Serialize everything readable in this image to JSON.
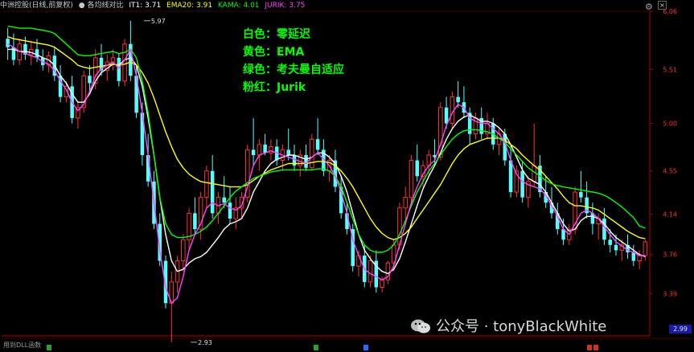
{
  "header": {
    "title": "中洲控股(日线,前复权)",
    "indicator_name": "● 各均线对比",
    "values": [
      {
        "label": "IT1: 3.71",
        "color": "#ffffff"
      },
      {
        "label": "EMA20: 3.91",
        "color": "#ffff00"
      },
      {
        "label": "KAMA: 4.01",
        "color": "#00ff00"
      },
      {
        "label": "JURIK: 3.75",
        "color": "#ff44ff"
      }
    ]
  },
  "legend": [
    {
      "text": "白色：零延迟",
      "color": "#ffffff"
    },
    {
      "text": "黄色：EMA",
      "color": "#ffff00"
    },
    {
      "text": "绿色：考夫曼自适应",
      "color": "#00ff00"
    },
    {
      "text": "粉红：Jurik",
      "color": "#ff44ff"
    }
  ],
  "footer_text": "用到DLL函数",
  "watermark": "公众号 · tonyBlackWhite",
  "chart_data": {
    "type": "candlestick",
    "y_ticks": [
      6.06,
      5.51,
      5.0,
      4.55,
      4.14,
      3.76,
      3.39
    ],
    "y_bottom_label": "2.99",
    "ylim": [
      2.99,
      6.06
    ],
    "annotations": [
      {
        "text": "5.97",
        "x": 23,
        "y": 5.97
      },
      {
        "text": "2.93",
        "x": 31,
        "y": 2.93
      }
    ],
    "colors": {
      "up": "#ff3232",
      "down": "#54ffff",
      "zero_lag": "#ffffff",
      "ema": "#ffff00",
      "kama": "#00ff00",
      "jurik": "#ff44ff",
      "axis": "#b00000",
      "tick_text": "#ff3232"
    },
    "candles": [
      [
        5.8,
        5.9,
        5.6,
        5.72
      ],
      [
        5.72,
        5.85,
        5.55,
        5.6
      ],
      [
        5.6,
        5.8,
        5.55,
        5.75
      ],
      [
        5.75,
        5.82,
        5.6,
        5.65
      ],
      [
        5.65,
        5.78,
        5.55,
        5.7
      ],
      [
        5.7,
        5.8,
        5.58,
        5.62
      ],
      [
        5.62,
        5.7,
        5.5,
        5.55
      ],
      [
        5.55,
        5.68,
        5.48,
        5.64
      ],
      [
        5.64,
        5.72,
        5.4,
        5.45
      ],
      [
        5.45,
        5.55,
        5.2,
        5.25
      ],
      [
        5.25,
        5.4,
        5.2,
        5.35
      ],
      [
        5.35,
        5.45,
        5.0,
        5.05
      ],
      [
        5.05,
        5.2,
        4.95,
        5.15
      ],
      [
        5.15,
        5.5,
        5.1,
        5.45
      ],
      [
        5.45,
        5.55,
        5.3,
        5.38
      ],
      [
        5.38,
        5.7,
        5.32,
        5.62
      ],
      [
        5.62,
        5.75,
        5.45,
        5.5
      ],
      [
        5.5,
        5.65,
        5.4,
        5.58
      ],
      [
        5.58,
        5.7,
        5.5,
        5.62
      ],
      [
        5.62,
        5.66,
        5.35,
        5.4
      ],
      [
        5.4,
        5.8,
        5.35,
        5.75
      ],
      [
        5.75,
        5.97,
        5.4,
        5.45
      ],
      [
        5.45,
        5.55,
        5.05,
        5.1
      ],
      [
        5.1,
        5.2,
        4.6,
        4.7
      ],
      [
        4.7,
        4.9,
        4.4,
        4.45
      ],
      [
        4.45,
        4.55,
        4.0,
        4.05
      ],
      [
        4.05,
        4.15,
        3.65,
        3.7
      ],
      [
        3.7,
        3.75,
        3.25,
        3.3
      ],
      [
        3.3,
        3.6,
        2.93,
        3.5
      ],
      [
        3.5,
        3.75,
        3.4,
        3.7
      ],
      [
        3.7,
        3.95,
        3.6,
        3.9
      ],
      [
        3.9,
        4.2,
        3.8,
        4.15
      ],
      [
        4.15,
        4.3,
        3.95,
        4.0
      ],
      [
        4.0,
        4.35,
        3.9,
        4.3
      ],
      [
        4.3,
        4.6,
        4.2,
        4.55
      ],
      [
        4.55,
        4.7,
        4.1,
        4.15
      ],
      [
        4.15,
        4.35,
        4.05,
        4.3
      ],
      [
        4.3,
        4.5,
        4.2,
        4.25
      ],
      [
        4.25,
        4.4,
        4.05,
        4.1
      ],
      [
        4.1,
        4.3,
        4.0,
        4.2
      ],
      [
        4.2,
        4.35,
        4.1,
        4.3
      ],
      [
        4.3,
        4.8,
        4.25,
        4.75
      ],
      [
        4.75,
        5.05,
        4.6,
        4.7
      ],
      [
        4.7,
        4.85,
        4.55,
        4.8
      ],
      [
        4.8,
        4.9,
        4.7,
        4.72
      ],
      [
        4.72,
        4.85,
        4.65,
        4.78
      ],
      [
        4.78,
        4.85,
        4.6,
        4.65
      ],
      [
        4.65,
        4.8,
        4.55,
        4.75
      ],
      [
        4.75,
        4.95,
        4.65,
        4.7
      ],
      [
        4.7,
        4.8,
        4.55,
        4.6
      ],
      [
        4.6,
        4.75,
        4.5,
        4.7
      ],
      [
        4.7,
        4.8,
        4.55,
        4.58
      ],
      [
        4.58,
        4.9,
        4.55,
        4.85
      ],
      [
        4.85,
        5.05,
        4.7,
        4.75
      ],
      [
        4.75,
        4.85,
        4.5,
        4.55
      ],
      [
        4.55,
        4.7,
        4.45,
        4.65
      ],
      [
        4.65,
        4.75,
        4.35,
        4.4
      ],
      [
        4.4,
        4.5,
        4.1,
        4.15
      ],
      [
        4.15,
        4.25,
        3.95,
        4.0
      ],
      [
        4.0,
        4.05,
        3.6,
        3.65
      ],
      [
        3.65,
        3.8,
        3.55,
        3.75
      ],
      [
        3.75,
        3.85,
        3.45,
        3.5
      ],
      [
        3.5,
        3.75,
        3.45,
        3.7
      ],
      [
        3.7,
        3.8,
        3.4,
        3.45
      ],
      [
        3.45,
        3.55,
        3.4,
        3.52
      ],
      [
        3.52,
        3.7,
        3.48,
        3.68
      ],
      [
        3.68,
        3.9,
        3.6,
        3.85
      ],
      [
        3.85,
        4.25,
        3.8,
        4.2
      ],
      [
        4.2,
        4.4,
        4.1,
        4.3
      ],
      [
        4.3,
        4.7,
        4.25,
        4.65
      ],
      [
        4.65,
        4.8,
        4.45,
        4.5
      ],
      [
        4.5,
        4.65,
        4.4,
        4.6
      ],
      [
        4.6,
        4.75,
        4.5,
        4.7
      ],
      [
        4.7,
        4.85,
        4.6,
        4.68
      ],
      [
        4.68,
        5.2,
        4.65,
        5.15
      ],
      [
        5.15,
        5.25,
        4.95,
        5.0
      ],
      [
        5.0,
        5.3,
        4.95,
        5.25
      ],
      [
        5.25,
        5.4,
        5.15,
        5.2
      ],
      [
        5.2,
        5.35,
        5.05,
        5.1
      ],
      [
        5.1,
        5.15,
        4.8,
        4.9
      ],
      [
        4.9,
        5.1,
        4.85,
        5.05
      ],
      [
        5.05,
        5.15,
        4.85,
        4.9
      ],
      [
        4.9,
        5.1,
        4.85,
        5.0
      ],
      [
        5.0,
        5.05,
        4.75,
        4.8
      ],
      [
        4.8,
        4.95,
        4.7,
        4.9
      ],
      [
        4.9,
        4.95,
        4.6,
        4.65
      ],
      [
        4.65,
        4.8,
        4.3,
        4.35
      ],
      [
        4.35,
        4.6,
        4.3,
        4.55
      ],
      [
        4.55,
        4.65,
        4.25,
        4.3
      ],
      [
        4.3,
        4.5,
        4.2,
        4.45
      ],
      [
        4.45,
        5.0,
        4.4,
        4.6
      ],
      [
        4.6,
        4.7,
        4.3,
        4.35
      ],
      [
        4.35,
        4.5,
        4.2,
        4.25
      ],
      [
        4.25,
        4.4,
        4.1,
        4.15
      ],
      [
        4.15,
        4.25,
        3.95,
        4.0
      ],
      [
        4.0,
        4.1,
        3.85,
        3.9
      ],
      [
        3.9,
        4.05,
        3.85,
        4.0
      ],
      [
        4.0,
        4.4,
        3.95,
        4.35
      ],
      [
        4.35,
        4.55,
        4.25,
        4.3
      ],
      [
        4.3,
        4.45,
        4.1,
        4.15
      ],
      [
        4.15,
        4.25,
        3.95,
        4.05
      ],
      [
        4.05,
        4.15,
        3.9,
        4.1
      ],
      [
        4.1,
        4.2,
        3.85,
        3.9
      ],
      [
        3.9,
        4.0,
        3.78,
        3.85
      ],
      [
        3.85,
        3.95,
        3.75,
        3.8
      ],
      [
        3.8,
        3.9,
        3.7,
        3.85
      ],
      [
        3.85,
        3.95,
        3.72,
        3.78
      ],
      [
        3.78,
        3.85,
        3.65,
        3.7
      ],
      [
        3.7,
        3.8,
        3.62,
        3.75
      ],
      [
        3.75,
        3.9,
        3.7,
        3.88
      ]
    ],
    "series": [
      {
        "name": "零延迟",
        "color": "#ffffff",
        "values": [
          5.7,
          5.7,
          5.68,
          5.68,
          5.67,
          5.65,
          5.62,
          5.6,
          5.55,
          5.45,
          5.38,
          5.28,
          5.2,
          5.2,
          5.28,
          5.4,
          5.48,
          5.52,
          5.56,
          5.55,
          5.6,
          5.62,
          5.55,
          5.35,
          5.05,
          4.7,
          4.3,
          3.95,
          3.7,
          3.6,
          3.62,
          3.68,
          3.72,
          3.74,
          3.78,
          3.85,
          3.92,
          4.0,
          4.05,
          4.07,
          4.1,
          4.2,
          4.35,
          4.45,
          4.55,
          4.62,
          4.66,
          4.68,
          4.7,
          4.7,
          4.68,
          4.66,
          4.68,
          4.72,
          4.72,
          4.68,
          4.62,
          4.5,
          4.35,
          4.15,
          3.95,
          3.8,
          3.72,
          3.65,
          3.6,
          3.58,
          3.62,
          3.72,
          3.88,
          4.05,
          4.22,
          4.38,
          4.5,
          4.6,
          4.72,
          4.85,
          4.95,
          5.02,
          5.06,
          5.08,
          5.05,
          5.02,
          5.02,
          5.0,
          4.96,
          4.9,
          4.8,
          4.68,
          4.56,
          4.48,
          4.45,
          4.42,
          4.35,
          4.25,
          4.15,
          4.05,
          3.98,
          4.0,
          4.08,
          4.12,
          4.12,
          4.1,
          4.05,
          3.98,
          3.92,
          3.88,
          3.84,
          3.8,
          3.76,
          3.74
        ]
      },
      {
        "name": "EMA",
        "color": "#ffff00",
        "values": [
          5.82,
          5.8,
          5.79,
          5.78,
          5.77,
          5.76,
          5.75,
          5.74,
          5.72,
          5.68,
          5.64,
          5.6,
          5.55,
          5.53,
          5.52,
          5.53,
          5.54,
          5.55,
          5.56,
          5.55,
          5.56,
          5.58,
          5.55,
          5.48,
          5.38,
          5.24,
          5.08,
          4.92,
          4.78,
          4.66,
          4.58,
          4.52,
          4.48,
          4.45,
          4.44,
          4.43,
          4.42,
          4.41,
          4.4,
          4.4,
          4.4,
          4.42,
          4.46,
          4.5,
          4.53,
          4.56,
          4.58,
          4.6,
          4.62,
          4.62,
          4.62,
          4.62,
          4.63,
          4.64,
          4.64,
          4.63,
          4.6,
          4.55,
          4.48,
          4.4,
          4.3,
          4.2,
          4.1,
          4.02,
          3.96,
          3.92,
          3.9,
          3.92,
          3.96,
          4.02,
          4.1,
          4.18,
          4.26,
          4.34,
          4.42,
          4.52,
          4.62,
          4.7,
          4.76,
          4.8,
          4.82,
          4.84,
          4.86,
          4.86,
          4.86,
          4.84,
          4.8,
          4.76,
          4.7,
          4.65,
          4.6,
          4.56,
          4.5,
          4.44,
          4.38,
          4.31,
          4.25,
          4.22,
          4.22,
          4.21,
          4.2,
          4.18,
          4.14,
          4.1,
          4.06,
          4.02,
          3.98,
          3.95,
          3.92,
          3.91
        ]
      },
      {
        "name": "考夫曼自适应",
        "color": "#00ff00",
        "values": [
          5.92,
          5.91,
          5.9,
          5.9,
          5.9,
          5.89,
          5.88,
          5.87,
          5.85,
          5.8,
          5.75,
          5.7,
          5.65,
          5.64,
          5.64,
          5.65,
          5.66,
          5.67,
          5.68,
          5.66,
          5.67,
          5.7,
          5.62,
          5.4,
          5.1,
          4.7,
          4.3,
          4.05,
          3.95,
          3.92,
          3.92,
          3.93,
          3.95,
          3.98,
          4.02,
          4.08,
          4.15,
          4.22,
          4.3,
          4.36,
          4.4,
          4.44,
          4.48,
          4.5,
          4.52,
          4.54,
          4.55,
          4.56,
          4.56,
          4.56,
          4.56,
          4.56,
          4.56,
          4.57,
          4.57,
          4.55,
          4.5,
          4.4,
          4.25,
          4.1,
          3.95,
          3.85,
          3.8,
          3.78,
          3.78,
          3.8,
          3.85,
          3.95,
          4.08,
          4.22,
          4.35,
          4.45,
          4.55,
          4.62,
          4.7,
          4.78,
          4.85,
          4.9,
          4.93,
          4.94,
          4.94,
          4.93,
          4.92,
          4.9,
          4.86,
          4.82,
          4.76,
          4.7,
          4.64,
          4.58,
          4.54,
          4.5,
          4.46,
          4.43,
          4.41,
          4.4,
          4.39,
          4.38,
          4.37,
          4.36,
          4.35,
          4.34,
          4.32,
          4.29,
          4.25,
          4.21,
          4.16,
          4.11,
          4.03,
          4.01
        ]
      },
      {
        "name": "Jurik",
        "color": "#ff44ff",
        "values": [
          5.75,
          5.72,
          5.68,
          5.66,
          5.64,
          5.62,
          5.58,
          5.56,
          5.5,
          5.4,
          5.32,
          5.2,
          5.12,
          5.18,
          5.3,
          5.45,
          5.52,
          5.55,
          5.58,
          5.52,
          5.6,
          5.7,
          5.45,
          5.1,
          4.7,
          4.25,
          3.8,
          3.45,
          3.3,
          3.35,
          3.55,
          3.8,
          3.95,
          4.05,
          4.2,
          4.25,
          4.22,
          4.24,
          4.2,
          4.18,
          4.22,
          4.4,
          4.6,
          4.7,
          4.72,
          4.74,
          4.72,
          4.7,
          4.68,
          4.66,
          4.64,
          4.62,
          4.68,
          4.72,
          4.66,
          4.6,
          4.5,
          4.35,
          4.15,
          3.9,
          3.75,
          3.62,
          3.58,
          3.55,
          3.52,
          3.55,
          3.65,
          3.85,
          4.05,
          4.25,
          4.4,
          4.52,
          4.6,
          4.65,
          4.8,
          4.98,
          5.1,
          5.18,
          5.15,
          5.05,
          5.02,
          5.0,
          5.0,
          4.95,
          4.9,
          4.82,
          4.65,
          4.52,
          4.45,
          4.42,
          4.4,
          4.38,
          4.32,
          4.22,
          4.12,
          4.0,
          3.95,
          4.05,
          4.15,
          4.18,
          4.15,
          4.1,
          4.02,
          3.95,
          3.88,
          3.84,
          3.8,
          3.78,
          3.75,
          3.75
        ]
      }
    ]
  }
}
